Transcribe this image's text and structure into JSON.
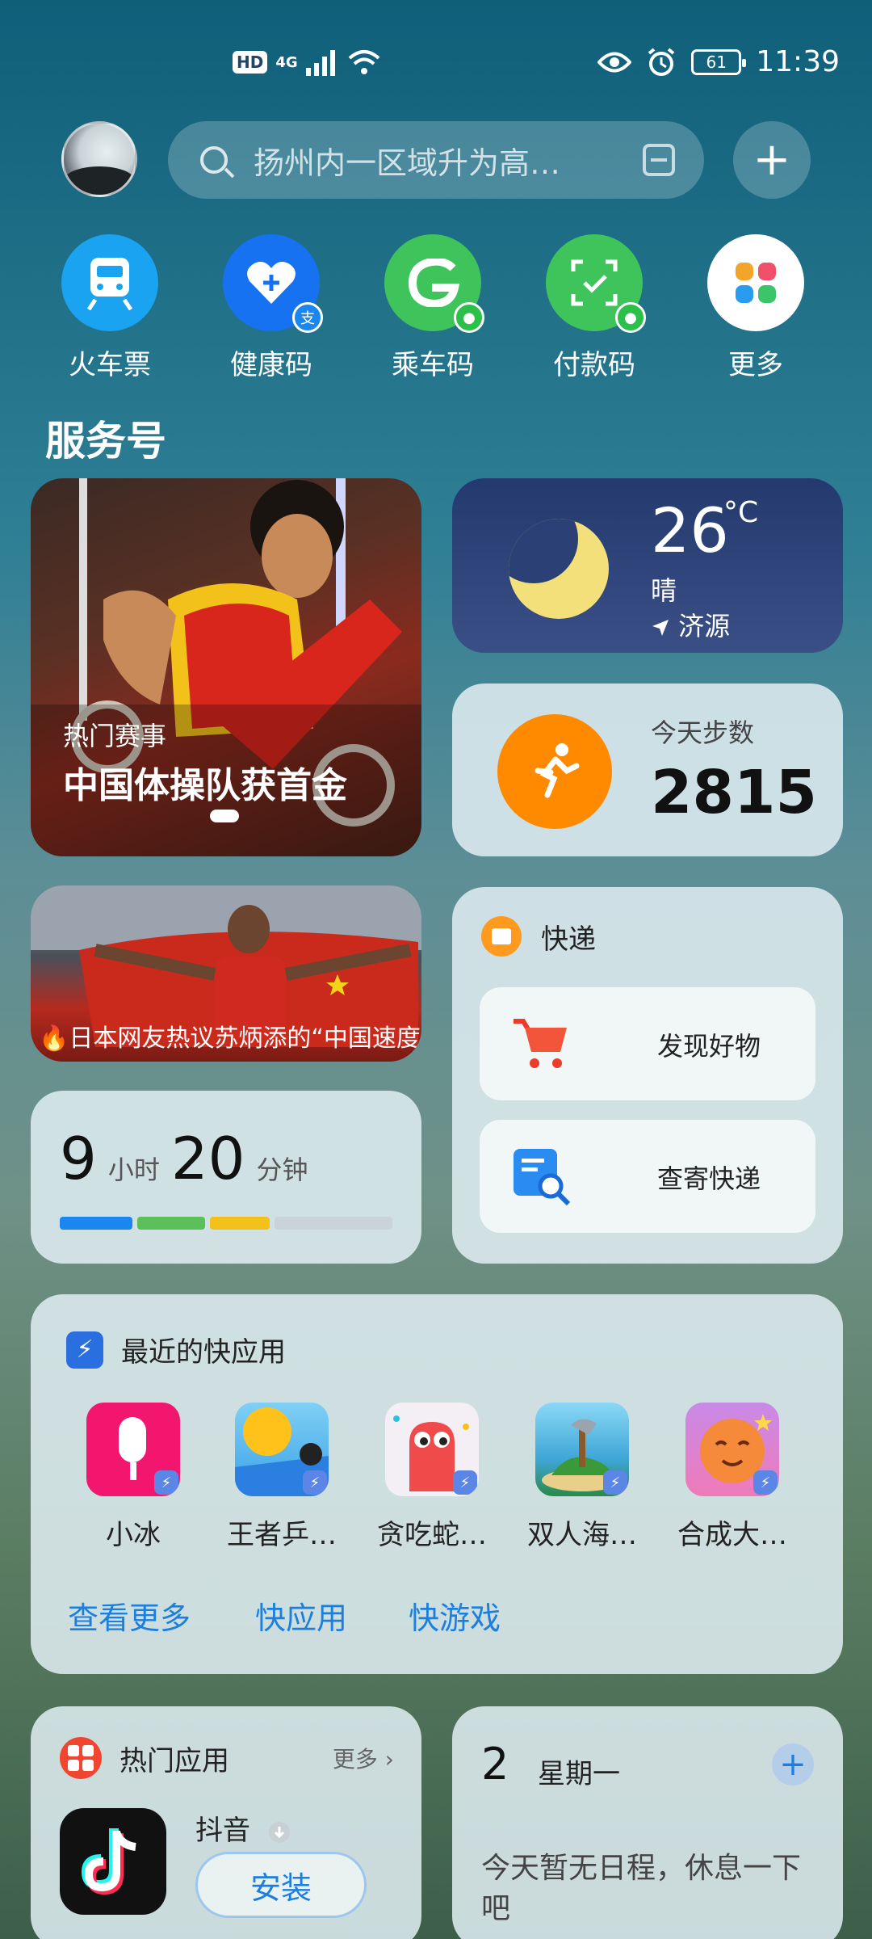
{
  "status_bar": {
    "hd": "HD",
    "signal": "4G",
    "battery": "61",
    "time": "11:39"
  },
  "search": {
    "placeholder": "扬州内一区域升为高…"
  },
  "shortcuts": [
    {
      "label": "火车票",
      "icon": "train-icon",
      "color": "#1aa3f0"
    },
    {
      "label": "健康码",
      "icon": "heart-plus-icon",
      "color": "#1672f0"
    },
    {
      "label": "乘车码",
      "icon": "bus-code-icon",
      "color": "#3fc45c"
    },
    {
      "label": "付款码",
      "icon": "pay-code-icon",
      "color": "#3fc45c"
    },
    {
      "label": "更多",
      "icon": "grid-icon",
      "color": "#ffffff"
    }
  ],
  "section_title": "服务号",
  "gym_card": {
    "tag": "热门赛事",
    "headline": "中国体操队获首金"
  },
  "weather": {
    "temperature": "26",
    "unit": "°C",
    "condition": "晴",
    "location": "济源"
  },
  "steps": {
    "label": "今天步数",
    "count": "2815"
  },
  "news": {
    "caption": "🔥日本网友热议苏炳添的“中国速度”"
  },
  "sleep": {
    "hours": "9",
    "hours_unit": "小时",
    "minutes": "20",
    "minutes_unit": "分钟",
    "bar_colors": [
      "#1a86f0",
      "#5cc05a",
      "#f2c21a",
      "#c9d3d8"
    ]
  },
  "express": {
    "title": "快递",
    "items": [
      {
        "label": "发现好物",
        "icon": "cart-icon"
      },
      {
        "label": "查寄快递",
        "icon": "parcel-search-icon"
      }
    ]
  },
  "quick_apps": {
    "title": "最近的快应用",
    "apps": [
      {
        "name": "小冰",
        "icon": "popsicle-icon"
      },
      {
        "name": "王者乒…",
        "icon": "ping-pong-icon"
      },
      {
        "name": "贪吃蛇…",
        "icon": "snake-icon"
      },
      {
        "name": "双人海…",
        "icon": "island-axe-icon"
      },
      {
        "name": "合成大…",
        "icon": "fruit-icon"
      }
    ],
    "links": [
      "查看更多",
      "快应用",
      "快游戏"
    ]
  },
  "hot_apps": {
    "title": "热门应用",
    "more": "更多",
    "app_name": "抖音",
    "install": "安装"
  },
  "calendar": {
    "date": "2",
    "weekday": "星期一",
    "empty_text": "今天暂无日程，休息一下吧"
  }
}
